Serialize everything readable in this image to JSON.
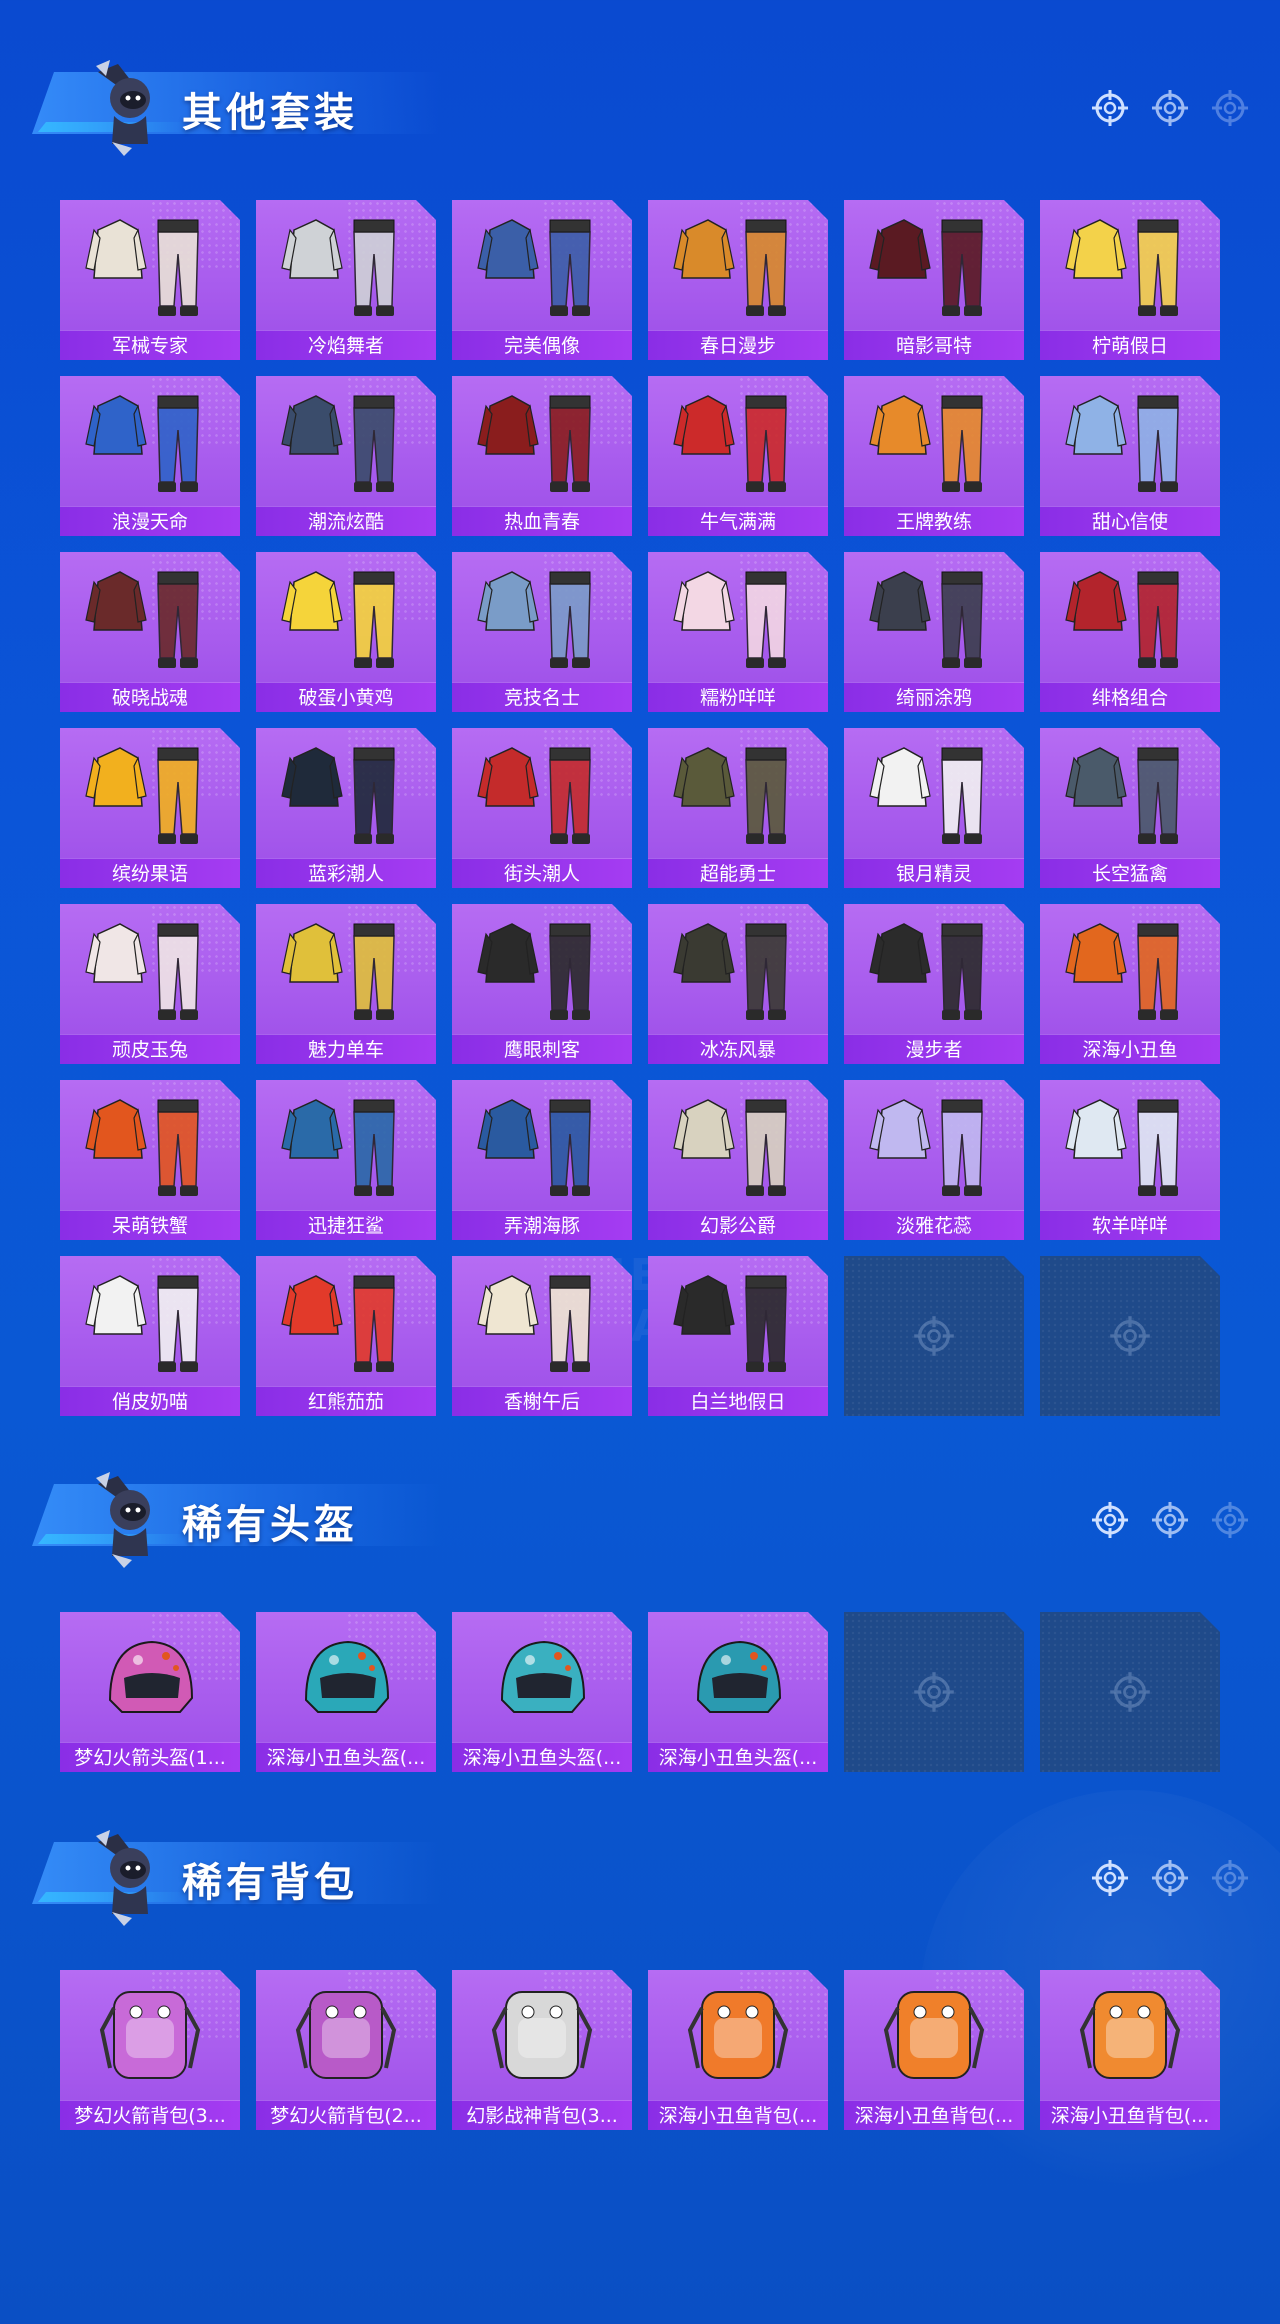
{
  "sections": [
    {
      "title": "其他套装",
      "items": [
        {
          "label": "军械专家",
          "icon": "outfit-icon",
          "color": "#e9e2d6"
        },
        {
          "label": "冷焰舞者",
          "icon": "outfit-icon",
          "color": "#cfd2d6"
        },
        {
          "label": "完美偶像",
          "icon": "outfit-icon",
          "color": "#3b5fa8"
        },
        {
          "label": "春日漫步",
          "icon": "outfit-icon",
          "color": "#d98a2a"
        },
        {
          "label": "暗影哥特",
          "icon": "outfit-icon",
          "color": "#5a1a22"
        },
        {
          "label": "柠萌假日",
          "icon": "outfit-icon",
          "color": "#f3d24a"
        },
        {
          "label": "浪漫天命",
          "icon": "outfit-icon",
          "color": "#2f63c9"
        },
        {
          "label": "潮流炫酷",
          "icon": "outfit-icon",
          "color": "#3a4c6b"
        },
        {
          "label": "热血青春",
          "icon": "outfit-icon",
          "color": "#8a1d1d"
        },
        {
          "label": "牛气满满",
          "icon": "outfit-icon",
          "color": "#cc2a2a"
        },
        {
          "label": "王牌教练",
          "icon": "outfit-icon",
          "color": "#e78a2a"
        },
        {
          "label": "甜心信使",
          "icon": "outfit-icon",
          "color": "#8fb2e6"
        },
        {
          "label": "破晓战魂",
          "icon": "outfit-icon",
          "color": "#6a2a2a"
        },
        {
          "label": "破蛋小黄鸡",
          "icon": "outfit-icon",
          "color": "#f5d43a"
        },
        {
          "label": "竞技名士",
          "icon": "outfit-icon",
          "color": "#7a9cc8"
        },
        {
          "label": "糯粉咩咩",
          "icon": "outfit-icon",
          "color": "#f3d7e4"
        },
        {
          "label": "绮丽涂鸦",
          "icon": "outfit-icon",
          "color": "#3b3f4d"
        },
        {
          "label": "绯格组合",
          "icon": "outfit-icon",
          "color": "#b3242c"
        },
        {
          "label": "缤纷果语",
          "icon": "outfit-icon",
          "color": "#f2b01e"
        },
        {
          "label": "蓝彩潮人",
          "icon": "outfit-icon",
          "color": "#1f2a3a"
        },
        {
          "label": "街头潮人",
          "icon": "outfit-icon",
          "color": "#c42b2b"
        },
        {
          "label": "超能勇士",
          "icon": "outfit-icon",
          "color": "#5a5a3a"
        },
        {
          "label": "银月精灵",
          "icon": "outfit-icon",
          "color": "#f2f2f2"
        },
        {
          "label": "长空猛禽",
          "icon": "outfit-icon",
          "color": "#4a5a6a"
        },
        {
          "label": "顽皮玉兔",
          "icon": "outfit-icon",
          "color": "#f0e6e6"
        },
        {
          "label": "魅力单车",
          "icon": "outfit-icon",
          "color": "#e0c03a"
        },
        {
          "label": "鹰眼刺客",
          "icon": "outfit-icon",
          "color": "#2a2a2a"
        },
        {
          "label": "冰冻风暴",
          "icon": "outfit-icon",
          "color": "#3a3a32"
        },
        {
          "label": "漫步者",
          "icon": "outfit-icon",
          "color": "#2b2b2b"
        },
        {
          "label": "深海小丑鱼",
          "icon": "outfit-icon",
          "color": "#e2671e"
        },
        {
          "label": "呆萌铁蟹",
          "icon": "outfit-icon",
          "color": "#e2561e"
        },
        {
          "label": "迅捷狂鲨",
          "icon": "outfit-icon",
          "color": "#2a6aa8"
        },
        {
          "label": "弄潮海豚",
          "icon": "outfit-icon",
          "color": "#2a5aa0"
        },
        {
          "label": "幻影公爵",
          "icon": "outfit-icon",
          "color": "#d8d2bf"
        },
        {
          "label": "淡雅花蕊",
          "icon": "outfit-icon",
          "color": "#c0b8f0"
        },
        {
          "label": "软羊咩咩",
          "icon": "outfit-icon",
          "color": "#dfe8f2"
        },
        {
          "label": "俏皮奶喵",
          "icon": "outfit-icon",
          "color": "#f2f2f2"
        },
        {
          "label": "红熊茄茄",
          "icon": "outfit-icon",
          "color": "#e23a2a"
        },
        {
          "label": "香榭午后",
          "icon": "outfit-icon",
          "color": "#efe6d2"
        },
        {
          "label": "白兰地假日",
          "icon": "outfit-icon",
          "color": "#2a2a2a"
        }
      ],
      "empty_slots": 2
    },
    {
      "title": "稀有头盔",
      "items": [
        {
          "label": "梦幻火箭头盔(1...",
          "icon": "helmet-icon",
          "color": "#d15ab5"
        },
        {
          "label": "深海小丑鱼头盔(...",
          "icon": "helmet-icon",
          "color": "#2aa8b8"
        },
        {
          "label": "深海小丑鱼头盔(...",
          "icon": "helmet-icon",
          "color": "#3ab0c0"
        },
        {
          "label": "深海小丑鱼头盔(...",
          "icon": "helmet-icon",
          "color": "#2a9ab0"
        }
      ],
      "empty_slots": 2
    },
    {
      "title": "稀有背包",
      "items": [
        {
          "label": "梦幻火箭背包(3...",
          "icon": "backpack-icon",
          "color": "#c86ad8"
        },
        {
          "label": "梦幻火箭背包(2...",
          "icon": "backpack-icon",
          "color": "#b85ac8"
        },
        {
          "label": "幻影战神背包(3...",
          "icon": "backpack-icon",
          "color": "#d8d8d8"
        },
        {
          "label": "深海小丑鱼背包(...",
          "icon": "backpack-icon",
          "color": "#f07a2a"
        },
        {
          "label": "深海小丑鱼背包(...",
          "icon": "backpack-icon",
          "color": "#f0802a"
        },
        {
          "label": "深海小丑鱼背包(...",
          "icon": "backpack-icon",
          "color": "#f08a30"
        }
      ],
      "empty_slots": 0
    }
  ]
}
